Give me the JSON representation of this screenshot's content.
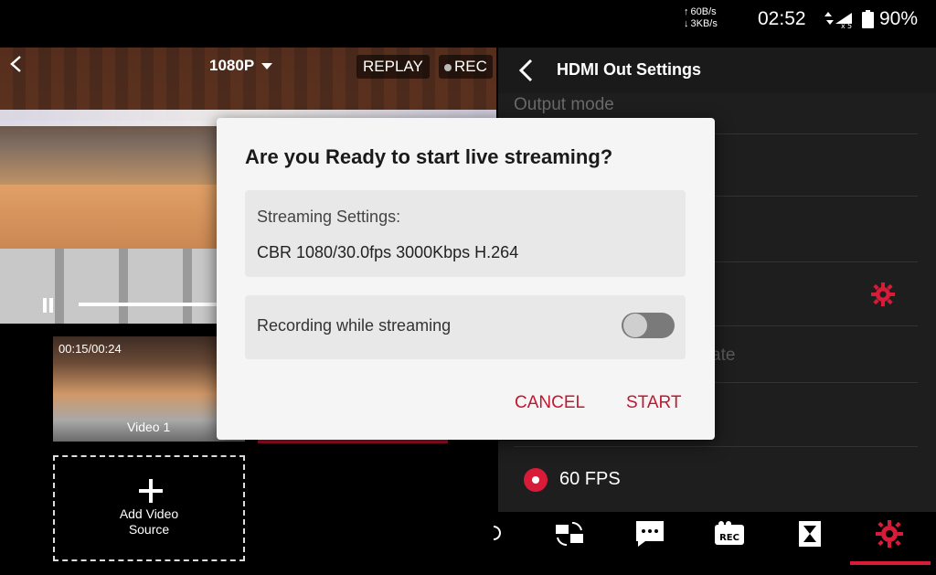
{
  "status_bar": {
    "net_up": "60B/s",
    "net_down": "3KB/s",
    "time": "02:52",
    "battery": "90%"
  },
  "preview": {
    "resolution": "1080P",
    "replay_label": "REPLAY",
    "rec_label": "REC"
  },
  "sources": {
    "video1_time": "00:15/00:24",
    "video1_label": "Video 1",
    "add_label_line1": "Add Video",
    "add_label_line2": "Source"
  },
  "panel": {
    "title": "HDMI Out Settings",
    "output_mode": "Output mode",
    "partial_text": "ate",
    "fps_label": "60 FPS"
  },
  "dialog": {
    "title": "Are you Ready to start live streaming?",
    "settings_label": "Streaming Settings:",
    "settings_value": "CBR 1080/30.0fps 3000Kbps H.264",
    "recording_label": "Recording while streaming",
    "recording_enabled": false,
    "cancel_label": "CANCEL",
    "start_label": "START"
  },
  "toolbar": {
    "icons": [
      "switch-camera-icon",
      "comment-icon",
      "rec-icon",
      "hourglass-icon",
      "settings-icon"
    ],
    "active_icon": "settings-icon"
  },
  "colors": {
    "accent": "#c2182f",
    "panel_bg": "#1e1e1e",
    "dialog_bg": "#f5f5f5"
  }
}
